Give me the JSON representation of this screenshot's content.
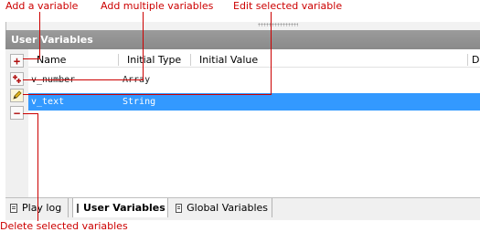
{
  "callouts": {
    "add_variable": "Add a variable",
    "add_multiple": "Add multiple variables",
    "edit_selected": "Edit selected variable",
    "delete_selected": "Delete selected variables"
  },
  "panel": {
    "title": "User Variables"
  },
  "toolbar": {
    "add_icon": "plus-icon",
    "add_multiple_icon": "plus-multiple-icon",
    "edit_icon": "pencil-icon",
    "delete_icon": "minus-icon"
  },
  "grid": {
    "columns": [
      "Name",
      "Initial Type",
      "Initial Value",
      "D"
    ],
    "rows": [
      {
        "name": "v_number",
        "type": "Array",
        "value": ""
      },
      {
        "name": "v_text",
        "type": "String",
        "value": ""
      }
    ],
    "selected_index": 1
  },
  "tabs": [
    {
      "label": "Play log",
      "active": false
    },
    {
      "label": "User Variables",
      "active": true
    },
    {
      "label": "Global Variables",
      "active": false
    }
  ],
  "colors": {
    "callout": "#cc0000",
    "selection": "#3399ff",
    "titlebar": "#8f8f8f"
  }
}
